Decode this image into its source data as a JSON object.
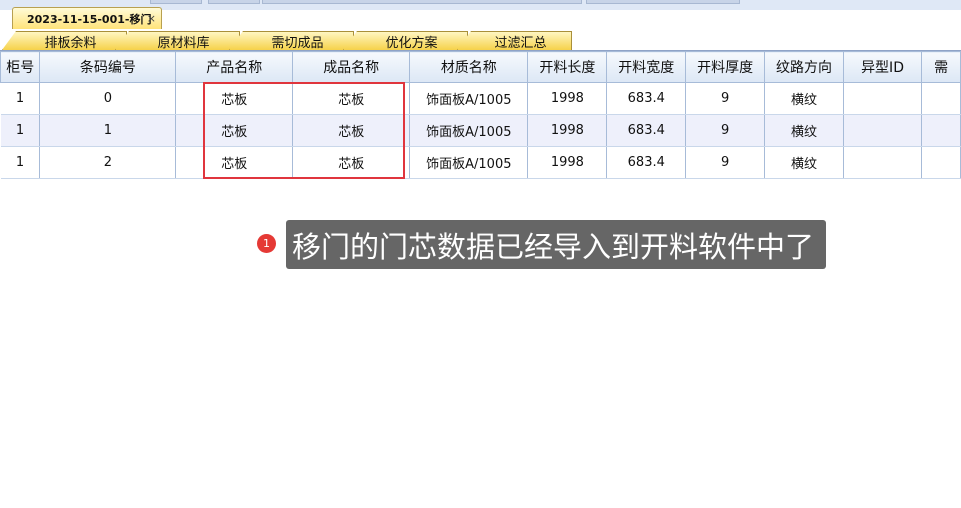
{
  "doc_tab": {
    "label": "2023-11-15-001-移门",
    "close": "×"
  },
  "sub_tabs": [
    "排板余料",
    "原材料库",
    "需切成品",
    "优化方案",
    "过滤汇总"
  ],
  "grid": {
    "columns": [
      "柜号",
      "条码编号",
      "产品名称",
      "成品名称",
      "材质名称",
      "开料长度",
      "开料宽度",
      "开料厚度",
      "纹路方向",
      "异型ID",
      "需"
    ],
    "rows": [
      [
        "1",
        "0",
        "芯板",
        "芯板",
        "饰面板A/1005",
        "1998",
        "683.4",
        "9",
        "横纹",
        "",
        ""
      ],
      [
        "1",
        "1",
        "芯板",
        "芯板",
        "饰面板A/1005",
        "1998",
        "683.4",
        "9",
        "横纹",
        "",
        ""
      ],
      [
        "1",
        "2",
        "芯板",
        "芯板",
        "饰面板A/1005",
        "1998",
        "683.4",
        "9",
        "横纹",
        "",
        ""
      ]
    ]
  },
  "annotation": {
    "number": "1",
    "text": "移门的门芯数据已经导入到开料软件中了"
  },
  "colors": {
    "highlight": "#e0353d",
    "annotation_bg": "#666666",
    "marker": "#e53935",
    "tab_gold": "#f6d24a"
  }
}
